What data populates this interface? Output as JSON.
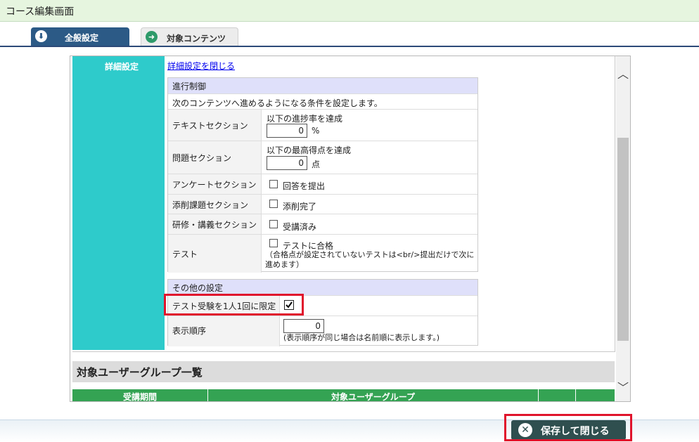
{
  "window": {
    "title": "コース編集画面"
  },
  "tabs": [
    {
      "label": "全般設定",
      "icon": "arrow-down-circle-icon",
      "active": true
    },
    {
      "label": "対象コンテンツ",
      "icon": "arrow-right-circle-icon",
      "active": false
    }
  ],
  "detail": {
    "header": "詳細設定",
    "close_link": "詳細設定を閉じる"
  },
  "progress": {
    "title": "進行制御",
    "description": "次のコンテンツへ進めるようになる条件を設定します。",
    "text_section": {
      "label": "テキストセクション",
      "condition": "以下の進捗率を達成",
      "value": "0",
      "unit": "%"
    },
    "question_section": {
      "label": "問題セクション",
      "condition": "以下の最高得点を達成",
      "value": "0",
      "unit": "点"
    },
    "survey_section": {
      "label": "アンケートセクション",
      "option": "回答を提出",
      "checked": false
    },
    "correction_section": {
      "label": "添削課題セクション",
      "option": "添削完了",
      "checked": false
    },
    "training_section": {
      "label": "研修・講義セクション",
      "option": "受講済み",
      "checked": false
    },
    "test": {
      "label": "テスト",
      "option": "テストに合格",
      "checked": false,
      "note": "（合格点が設定されていないテストは<br/>提出だけで次に進めます）"
    }
  },
  "other": {
    "title": "その他の設定",
    "limit_once": {
      "label": "テスト受験を1人1回に限定",
      "checked": true
    },
    "display_order": {
      "label": "表示順序",
      "value": "0",
      "note": "(表示順序が同じ場合は名前順に表示します。)"
    }
  },
  "user_group": {
    "title": "対象ユーザーグループ一覧",
    "columns": [
      "受講期間",
      "対象ユーザーグループ"
    ]
  },
  "footer": {
    "save_button": "保存して閉じる"
  },
  "colors": {
    "accent_teal": "#2ecbcb",
    "tab_blue": "#2c5a86",
    "table_green": "#34a353",
    "highlight_red": "#e0142c"
  }
}
